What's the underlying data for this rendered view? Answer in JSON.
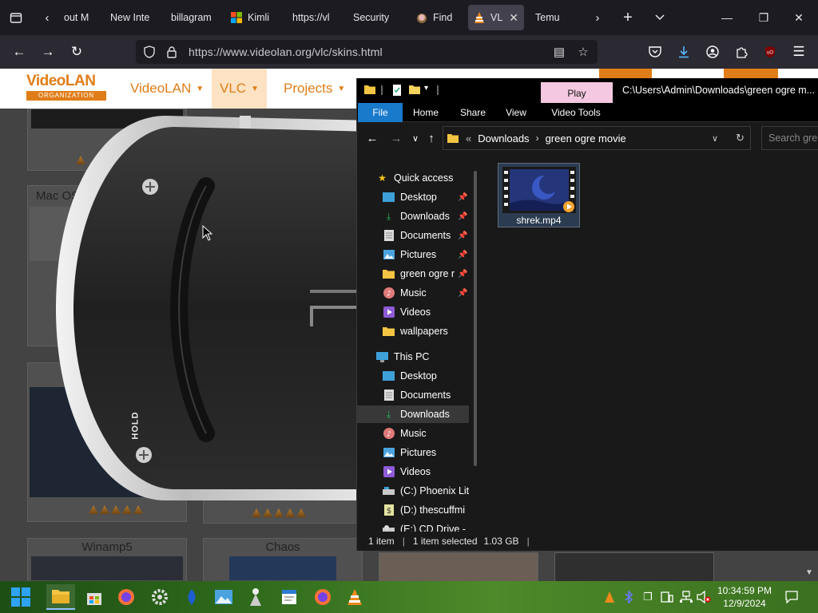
{
  "browser": {
    "tabs": [
      {
        "label": "out M"
      },
      {
        "label": "New Inte"
      },
      {
        "label": "billagram"
      },
      {
        "label": "Kimli"
      },
      {
        "label": "https://vl"
      },
      {
        "label": "Security"
      },
      {
        "label": "Find"
      },
      {
        "label": "VL"
      },
      {
        "label": "Temu"
      }
    ],
    "active_tab_index": 7,
    "url": "https://www.videolan.org/vlc/skins.html"
  },
  "site": {
    "logo_top": "VideoLAN",
    "logo_bottom": "ORGANIZATION",
    "nav": [
      {
        "label": "VideoLAN"
      },
      {
        "label": "VLC"
      },
      {
        "label": "Projects"
      }
    ],
    "skin_titles": [
      "Mac OS",
      "Winamp5",
      "Chaos"
    ],
    "psp_hold_label": "HOLD"
  },
  "explorer": {
    "title_path": "C:\\Users\\Admin\\Downloads\\green ogre m...",
    "play_tab": "Play",
    "ribbon_tabs": [
      "File",
      "Home",
      "Share",
      "View",
      "Video Tools"
    ],
    "breadcrumb_overflow": "«",
    "breadcrumb": [
      "Downloads",
      "green ogre movie"
    ],
    "search_placeholder": "Search gre",
    "nav_items": [
      {
        "label": "Quick access",
        "icon": "star-icon",
        "group": "header"
      },
      {
        "label": "Desktop",
        "icon": "desktop-icon",
        "pinned": true
      },
      {
        "label": "Downloads",
        "icon": "download-icon",
        "pinned": true
      },
      {
        "label": "Documents",
        "icon": "documents-icon",
        "pinned": true
      },
      {
        "label": "Pictures",
        "icon": "pictures-icon",
        "pinned": true
      },
      {
        "label": "green ogre r",
        "icon": "folder-icon",
        "pinned": true
      },
      {
        "label": "Music",
        "icon": "music-icon",
        "pinned": true
      },
      {
        "label": "Videos",
        "icon": "videos-icon",
        "pinned": false
      },
      {
        "label": "wallpapers",
        "icon": "folder-icon",
        "pinned": false
      },
      {
        "label": "This PC",
        "icon": "computer-icon",
        "group": "header"
      },
      {
        "label": "Desktop",
        "icon": "desktop-icon"
      },
      {
        "label": "Documents",
        "icon": "documents-icon"
      },
      {
        "label": "Downloads",
        "icon": "download-icon",
        "selected": true
      },
      {
        "label": "Music",
        "icon": "music-icon"
      },
      {
        "label": "Pictures",
        "icon": "pictures-icon"
      },
      {
        "label": "Videos",
        "icon": "videos-icon"
      },
      {
        "label": "(C:) Phoenix Lit",
        "icon": "drive-icon"
      },
      {
        "label": "(D:) thescuffmi",
        "icon": "drive-icon"
      },
      {
        "label": "(E:) CD Drive -",
        "icon": "cd-drive-icon"
      }
    ],
    "files": [
      {
        "name": "shrek.mp4",
        "selected": true
      }
    ],
    "status": {
      "count": "1 item",
      "selected": "1 item selected",
      "size": "1.03 GB"
    }
  },
  "taskbar": {
    "apps": [
      "file-explorer-icon",
      "store-icon",
      "firefox-icon",
      "settings-icon",
      "app-blue-icon",
      "image-viewer-icon",
      "app-figure-icon",
      "notepad-icon",
      "firefox-icon",
      "vlc-icon"
    ],
    "time": "10:34:59 PM",
    "date": "12/9/2024"
  },
  "colors": {
    "accent_orange": "#e07d18",
    "explorer_file_tab": "#1979ca",
    "play_tab": "#f4c8e0"
  }
}
